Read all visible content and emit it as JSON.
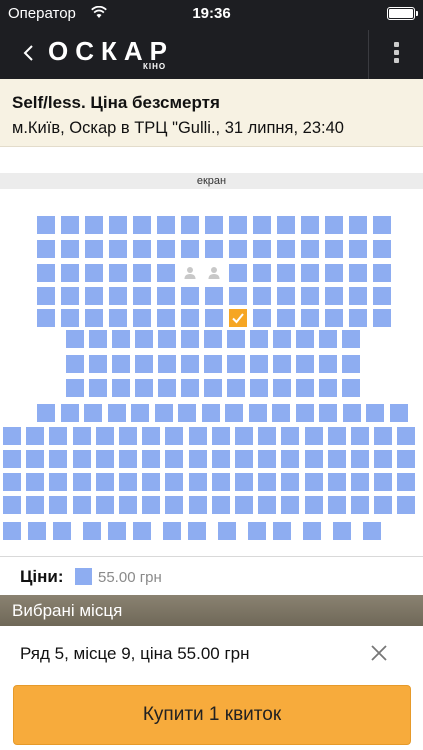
{
  "status_bar": {
    "carrier": "Оператор",
    "time": "19:36"
  },
  "nav": {
    "logo": "ОСКАР",
    "logo_sub": "КІНО"
  },
  "movie": {
    "title": "Self/less. Ціна безсмертя",
    "details": "м.Київ, Оскар в ТРЦ \"Gulli., 31 липня, 23:40"
  },
  "hall": {
    "screen_label": "екран",
    "seat_color": "#8eadf1",
    "selected_color": "#f6a623",
    "rows": [
      {
        "row": 1,
        "seats": 15
      },
      {
        "row": 2,
        "seats": 15
      },
      {
        "row": 3,
        "seats": 15
      },
      {
        "row": 4,
        "seats": 15
      },
      {
        "row": 5,
        "seats": 15,
        "selected_seat": 9
      },
      {
        "row": 6,
        "seats": 13
      },
      {
        "row": 7,
        "seats": 13
      },
      {
        "row": 8,
        "seats": 13
      },
      {
        "row": 9,
        "seats": 16
      },
      {
        "row": 10,
        "seats": 18
      },
      {
        "row": 11,
        "seats": 18
      },
      {
        "row": 12,
        "seats": 18
      },
      {
        "row": 13,
        "seats": 18
      },
      {
        "row": 14,
        "seats": 14
      }
    ]
  },
  "prices": {
    "label": "Ціни:",
    "value": "55.00 грн"
  },
  "selected": {
    "header": "Вибрані місця",
    "ticket": "Ряд 5, місце 9, ціна 55.00 грн"
  },
  "buy_button": "Купити 1 квиток"
}
